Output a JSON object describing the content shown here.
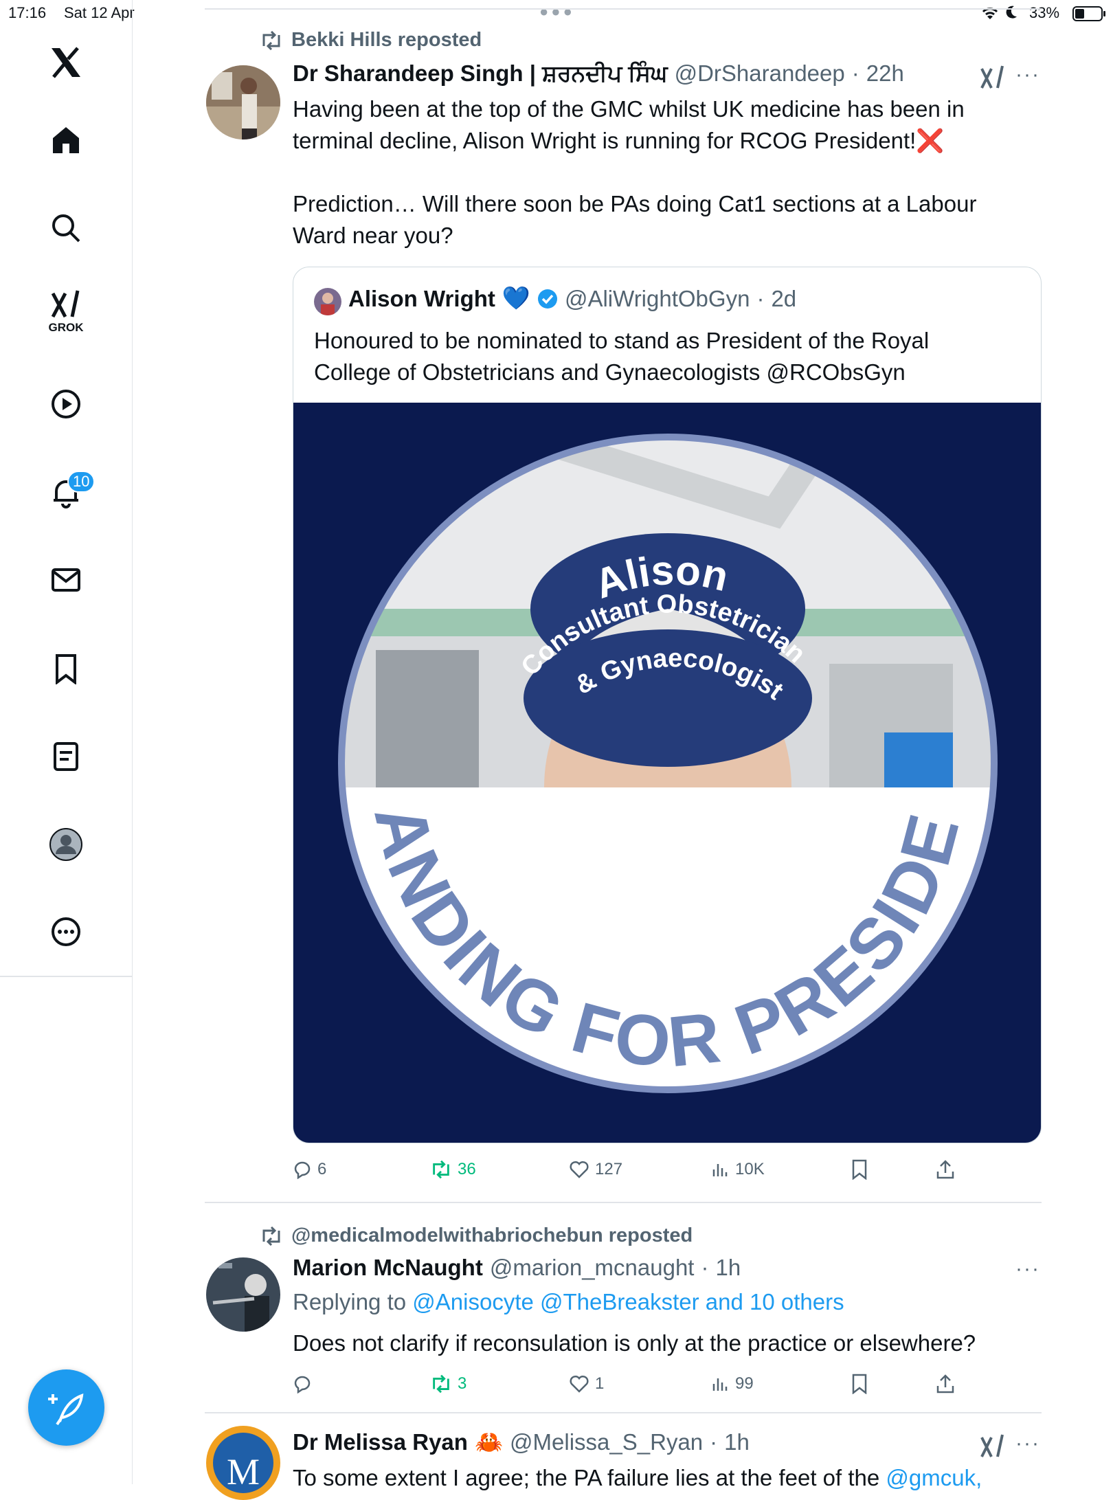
{
  "status_bar": {
    "time": "17:16",
    "date": "Sat 12 Apr",
    "battery": "33%"
  },
  "sidebar": {
    "items": [
      "x-logo-icon",
      "home-icon",
      "search-icon",
      "grok-icon",
      "video-icon",
      "notifications-icon",
      "messages-icon",
      "bookmarks-icon",
      "lists-icon",
      "profile-icon",
      "more-icon"
    ],
    "grok_label": "GROK",
    "notification_badge": "10"
  },
  "post1": {
    "repost_by": "Bekki Hills reposted",
    "author_name": "Dr Sharandeep Singh | ਸ਼ਰਨਦੀਪ ਸਿੰਘ",
    "handle": "@DrSharandeep",
    "time": "22h",
    "text_line1": "Having been at the top of the GMC whilst UK medicine has been in",
    "text_line2": "terminal decline, Alison Wright is running for RCOG President!",
    "text_emoji": "❌",
    "text_line3": "Prediction… Will there soon be PAs doing Cat1 sections at a Labour",
    "text_line4": "Ward near you?",
    "quote": {
      "author_name": "Alison Wright",
      "heart_emoji": "💙",
      "handle": "@AliWrightObGyn",
      "time": "2d",
      "text_line1": "Honoured to be nominated to stand as President of the Royal",
      "text_line2": "College of Obstetricians and Gynaecologists @RCObsGyn",
      "image": {
        "cap_line1": "Alison",
        "cap_line2": "Consultant Obstetrician",
        "cap_line3": "& Gynaecologist",
        "banner_text": "STANDING FOR PRESIDENT",
        "background_color": "#0b1a4f",
        "banner_text_color": "#6f86b8"
      }
    },
    "actions": {
      "replies": "6",
      "reposts": "36",
      "likes": "127",
      "views": "10K"
    }
  },
  "post2": {
    "repost_by": "@medicalmodelwithabriochebun reposted",
    "author_name": "Marion McNaught",
    "handle": "@marion_mcnaught",
    "time": "1h",
    "replying_to_label": "Replying to",
    "replying_to_users": "@Anisocyte @TheBreakster and 10 others",
    "text": "Does not clarify if reconsulation is only at the practice or elsewhere?",
    "actions": {
      "replies": "",
      "reposts": "3",
      "likes": "1",
      "views": "99"
    }
  },
  "post3": {
    "author_name": "Dr Melissa Ryan",
    "emoji": "🦀",
    "handle": "@Melissa_S_Ryan",
    "time": "1h",
    "text": "To some extent I agree; the PA failure lies at the feet of the",
    "mention": "@gmcuk,",
    "avatar_letter": "M"
  },
  "colors": {
    "accent": "#1d9bf0",
    "repost_green": "#00ba7c",
    "muted": "#536471"
  }
}
